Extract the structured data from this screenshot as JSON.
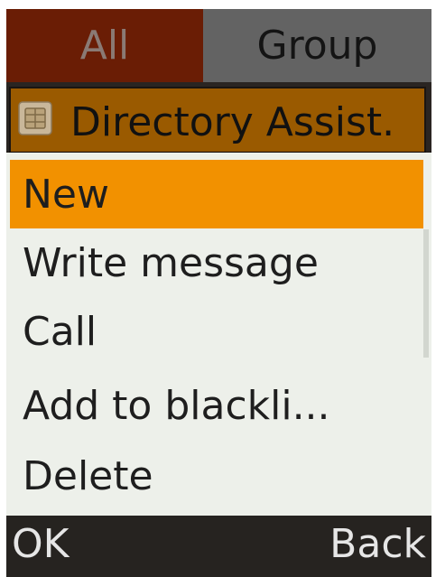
{
  "tabs": {
    "all_label": "All",
    "group_label": "Group",
    "active": "All"
  },
  "contact": {
    "name": "Directory Assist.",
    "icon": "sim-card-icon"
  },
  "menu": {
    "items": [
      {
        "label": "New",
        "selected": true
      },
      {
        "label": "Write message",
        "selected": false
      },
      {
        "label": "Call",
        "selected": false
      },
      {
        "label": "Add to blackli...",
        "selected": false
      },
      {
        "label": "Delete",
        "selected": false
      }
    ]
  },
  "softkeys": {
    "left_label": "OK",
    "right_label": "Back"
  },
  "colors": {
    "tab_active": "#6a1d05",
    "tab_inactive": "#636363",
    "contact_highlight": "#9a5a00",
    "menu_selected": "#f29100",
    "menu_background": "#edf0ea",
    "softkey_bar": "#262320"
  }
}
